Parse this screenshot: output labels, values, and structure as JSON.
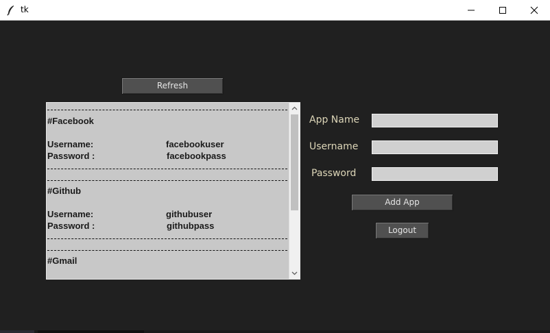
{
  "window": {
    "title": "tk",
    "icon": "feather-icon",
    "controls": [
      "minimize-icon",
      "maximize-icon",
      "close-icon"
    ]
  },
  "toolbar": {
    "refresh_label": "Refresh"
  },
  "entries": [
    {
      "title": "#Facebook",
      "username_label": "Username:",
      "username": "facebookuser",
      "password_label": "Password :",
      "password": "facebookpass"
    },
    {
      "title": "#Github",
      "username_label": "Username:",
      "username": "githubuser",
      "password_label": "Password :",
      "password": "githubpass"
    },
    {
      "title": "#Gmail"
    }
  ],
  "form": {
    "app_name_label": "App Name",
    "app_name_value": "",
    "username_label": "Username",
    "username_value": "",
    "password_label": "Password",
    "password_value": "",
    "add_app_label": "Add App",
    "logout_label": "Logout"
  },
  "colors": {
    "background": "#202020",
    "button": "#505050",
    "label_text": "#ddd6b8",
    "listbox": "#c8c8c8"
  }
}
